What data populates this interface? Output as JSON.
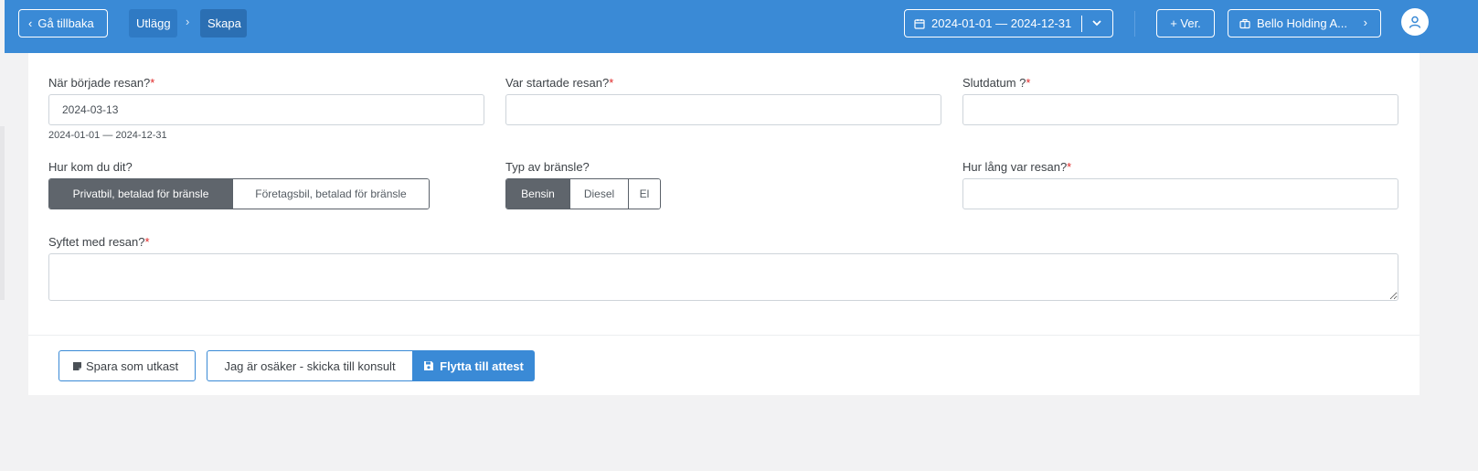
{
  "header": {
    "back_label": "Gå tillbaka",
    "breadcrumb": [
      "Utlägg",
      "Skapa"
    ],
    "date_range": "2024-01-01 — 2024-12-31",
    "new_voucher_label": "+ Ver.",
    "company_label": "Bello Holding A..."
  },
  "form": {
    "start_date": {
      "label": "När började resan?",
      "required_mark": "*",
      "value": "2024-03-13",
      "hint": "2024-01-01 — 2024-12-31"
    },
    "start_place": {
      "label": "Var startade resan?",
      "required_mark": "*",
      "value": ""
    },
    "end_date": {
      "label": "Slutdatum ?",
      "required_mark": "*",
      "value": ""
    },
    "transport": {
      "label": "Hur kom du dit?",
      "options": [
        "Privatbil, betalad för bränsle",
        "Företagsbil, betalad för bränsle"
      ],
      "selected": "Privatbil, betalad för bränsle"
    },
    "fuel": {
      "label": "Typ av bränsle?",
      "options": [
        "Bensin",
        "Diesel",
        "El"
      ],
      "selected": "Bensin"
    },
    "distance": {
      "label": "Hur lång var resan?",
      "required_mark": "*",
      "value": ""
    },
    "purpose": {
      "label": "Syftet med resan?",
      "required_mark": "*",
      "value": ""
    }
  },
  "footer": {
    "draft_label": "Spara som utkast",
    "consult_label": "Jag är osäker - skicka till konsult",
    "attest_label": "Flytta till attest"
  },
  "colors": {
    "primary": "#3a8ad6",
    "active_segment": "#5f656c",
    "required": "#e02a2a"
  },
  "icons": [
    "chevron-left-icon",
    "chevron-right-icon",
    "calendar-icon",
    "chevron-down-icon",
    "briefcase-icon",
    "user-icon",
    "note-icon",
    "save-icon"
  ]
}
